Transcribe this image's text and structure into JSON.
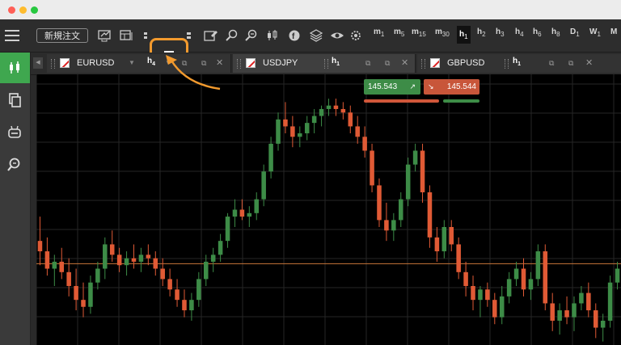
{
  "window": {
    "traffic_lights": [
      "#ff5f57",
      "#febc2e",
      "#28c840"
    ]
  },
  "toolbar": {
    "new_order_label": "新規注文",
    "timeframes": [
      {
        "base": "m",
        "sub": "1"
      },
      {
        "base": "m",
        "sub": "5"
      },
      {
        "base": "m",
        "sub": "15"
      },
      {
        "base": "m",
        "sub": "30"
      },
      {
        "base": "h",
        "sub": "1",
        "selected": true
      },
      {
        "base": "h",
        "sub": "2"
      },
      {
        "base": "h",
        "sub": "3"
      },
      {
        "base": "h",
        "sub": "4"
      },
      {
        "base": "h",
        "sub": "6"
      },
      {
        "base": "h",
        "sub": "8"
      },
      {
        "base": "D",
        "sub": "1"
      },
      {
        "base": "W",
        "sub": "1"
      },
      {
        "base": "M",
        "sub": ""
      }
    ]
  },
  "sidebar": {
    "items": [
      "chart-icon",
      "copy-icon",
      "robot-icon",
      "zoom-search-icon"
    ]
  },
  "tabs": [
    {
      "symbol": "EURUSD",
      "timeframe": "h",
      "timeframe_sub": "4"
    },
    {
      "symbol": "USDJPY",
      "timeframe": "h",
      "timeframe_sub": "1",
      "active": true
    },
    {
      "symbol": "GBPUSD",
      "timeframe": "h",
      "timeframe_sub": "1"
    }
  ],
  "quote": {
    "bid": "145.543",
    "ask": "145.544",
    "bid_arrow": "↗",
    "ask_arrow": "↘"
  },
  "colors": {
    "up": "#3d8c47",
    "down": "#e05a35",
    "highlight": "#f29a2e",
    "price_line": "#c8763a"
  },
  "chart_data": {
    "type": "candlestick",
    "symbol": "USDJPY",
    "timeframe": "h1",
    "candles": [
      [
        146.2,
        146.9,
        145.5,
        145.9
      ],
      [
        145.9,
        146.3,
        145.2,
        145.4
      ],
      [
        145.4,
        145.8,
        144.9,
        145.6
      ],
      [
        145.6,
        146.0,
        145.1,
        145.3
      ],
      [
        145.3,
        145.7,
        144.6,
        144.9
      ],
      [
        144.9,
        145.4,
        144.2,
        144.5
      ],
      [
        144.5,
        145.0,
        144.0,
        144.3
      ],
      [
        144.3,
        145.2,
        144.1,
        145.0
      ],
      [
        145.0,
        145.6,
        144.8,
        145.4
      ],
      [
        145.4,
        146.3,
        145.1,
        146.1
      ],
      [
        146.1,
        146.5,
        145.6,
        145.8
      ],
      [
        145.8,
        146.0,
        145.3,
        145.5
      ],
      [
        145.5,
        145.9,
        145.2,
        145.7
      ],
      [
        145.7,
        146.1,
        145.4,
        145.6
      ],
      [
        145.6,
        146.0,
        145.3,
        145.8
      ],
      [
        145.8,
        146.1,
        145.5,
        145.7
      ],
      [
        145.7,
        145.9,
        145.2,
        145.4
      ],
      [
        145.4,
        145.7,
        144.9,
        145.1
      ],
      [
        145.1,
        145.4,
        144.6,
        144.8
      ],
      [
        144.8,
        145.1,
        144.3,
        144.5
      ],
      [
        144.5,
        144.8,
        144.0,
        144.2
      ],
      [
        144.2,
        144.7,
        143.9,
        144.5
      ],
      [
        144.5,
        145.3,
        144.3,
        145.1
      ],
      [
        145.1,
        145.8,
        144.9,
        145.6
      ],
      [
        145.6,
        146.0,
        145.3,
        145.8
      ],
      [
        145.8,
        146.4,
        145.6,
        146.2
      ],
      [
        146.2,
        147.0,
        146.0,
        146.9
      ],
      [
        146.9,
        147.4,
        146.6,
        147.1
      ],
      [
        147.1,
        147.4,
        146.8,
        146.9
      ],
      [
        146.9,
        147.2,
        146.6,
        147.0
      ],
      [
        147.0,
        147.6,
        146.8,
        147.4
      ],
      [
        147.4,
        148.4,
        147.2,
        148.2
      ],
      [
        148.2,
        149.2,
        148.0,
        149.0
      ],
      [
        149.0,
        149.9,
        148.8,
        149.7
      ],
      [
        149.7,
        150.2,
        149.3,
        149.5
      ],
      [
        149.5,
        149.8,
        148.9,
        149.2
      ],
      [
        149.2,
        149.5,
        148.9,
        149.3
      ],
      [
        149.3,
        149.8,
        149.1,
        149.6
      ],
      [
        149.6,
        150.0,
        149.3,
        149.8
      ],
      [
        149.8,
        150.1,
        149.5,
        150.0
      ],
      [
        150.0,
        150.3,
        149.8,
        150.1
      ],
      [
        150.1,
        150.3,
        149.8,
        150.0
      ],
      [
        150.0,
        150.2,
        149.7,
        149.9
      ],
      [
        149.9,
        150.1,
        149.3,
        149.5
      ],
      [
        149.5,
        149.8,
        149.0,
        149.2
      ],
      [
        149.2,
        149.5,
        148.6,
        148.8
      ],
      [
        148.8,
        149.0,
        147.6,
        147.8
      ],
      [
        147.8,
        148.0,
        146.6,
        146.8
      ],
      [
        146.8,
        147.3,
        146.2,
        146.5
      ],
      [
        146.5,
        147.0,
        146.2,
        146.8
      ],
      [
        146.8,
        147.6,
        146.6,
        147.4
      ],
      [
        147.4,
        148.6,
        147.2,
        148.4
      ],
      [
        148.4,
        149.0,
        148.2,
        148.8
      ],
      [
        148.8,
        149.0,
        147.3,
        147.6
      ],
      [
        147.6,
        147.8,
        146.0,
        146.3
      ],
      [
        146.3,
        146.6,
        145.6,
        145.9
      ],
      [
        145.9,
        146.8,
        145.7,
        146.6
      ],
      [
        146.6,
        146.8,
        145.9,
        146.1
      ],
      [
        146.1,
        146.3,
        145.1,
        145.3
      ],
      [
        145.3,
        145.6,
        144.6,
        144.9
      ],
      [
        144.9,
        145.2,
        144.2,
        144.5
      ],
      [
        144.5,
        144.9,
        144.0,
        144.8
      ],
      [
        144.8,
        145.0,
        144.3,
        144.5
      ],
      [
        144.5,
        144.7,
        143.8,
        144.0
      ],
      [
        144.0,
        144.9,
        143.8,
        144.6
      ],
      [
        144.6,
        145.3,
        144.4,
        145.1
      ],
      [
        145.1,
        145.6,
        144.9,
        145.4
      ],
      [
        145.4,
        145.7,
        144.6,
        144.8
      ],
      [
        144.8,
        145.3,
        144.5,
        145.1
      ],
      [
        145.1,
        146.1,
        144.9,
        145.9
      ],
      [
        145.9,
        146.1,
        144.2,
        144.4
      ],
      [
        144.4,
        144.7,
        143.6,
        143.9
      ],
      [
        143.9,
        144.4,
        143.5,
        144.2
      ],
      [
        144.2,
        144.6,
        143.8,
        144.0
      ],
      [
        144.0,
        144.6,
        143.6,
        144.4
      ],
      [
        144.4,
        144.9,
        144.2,
        144.7
      ],
      [
        144.7,
        145.0,
        144.0,
        144.2
      ],
      [
        144.2,
        144.4,
        143.4,
        143.7
      ],
      [
        143.7,
        144.1,
        143.3,
        143.9
      ],
      [
        143.9,
        145.2,
        143.7,
        145.0
      ],
      [
        145.0,
        145.6,
        144.8,
        145.4
      ]
    ],
    "current_price": 145.543,
    "y_range": [
      143.2,
      151.0
    ]
  }
}
